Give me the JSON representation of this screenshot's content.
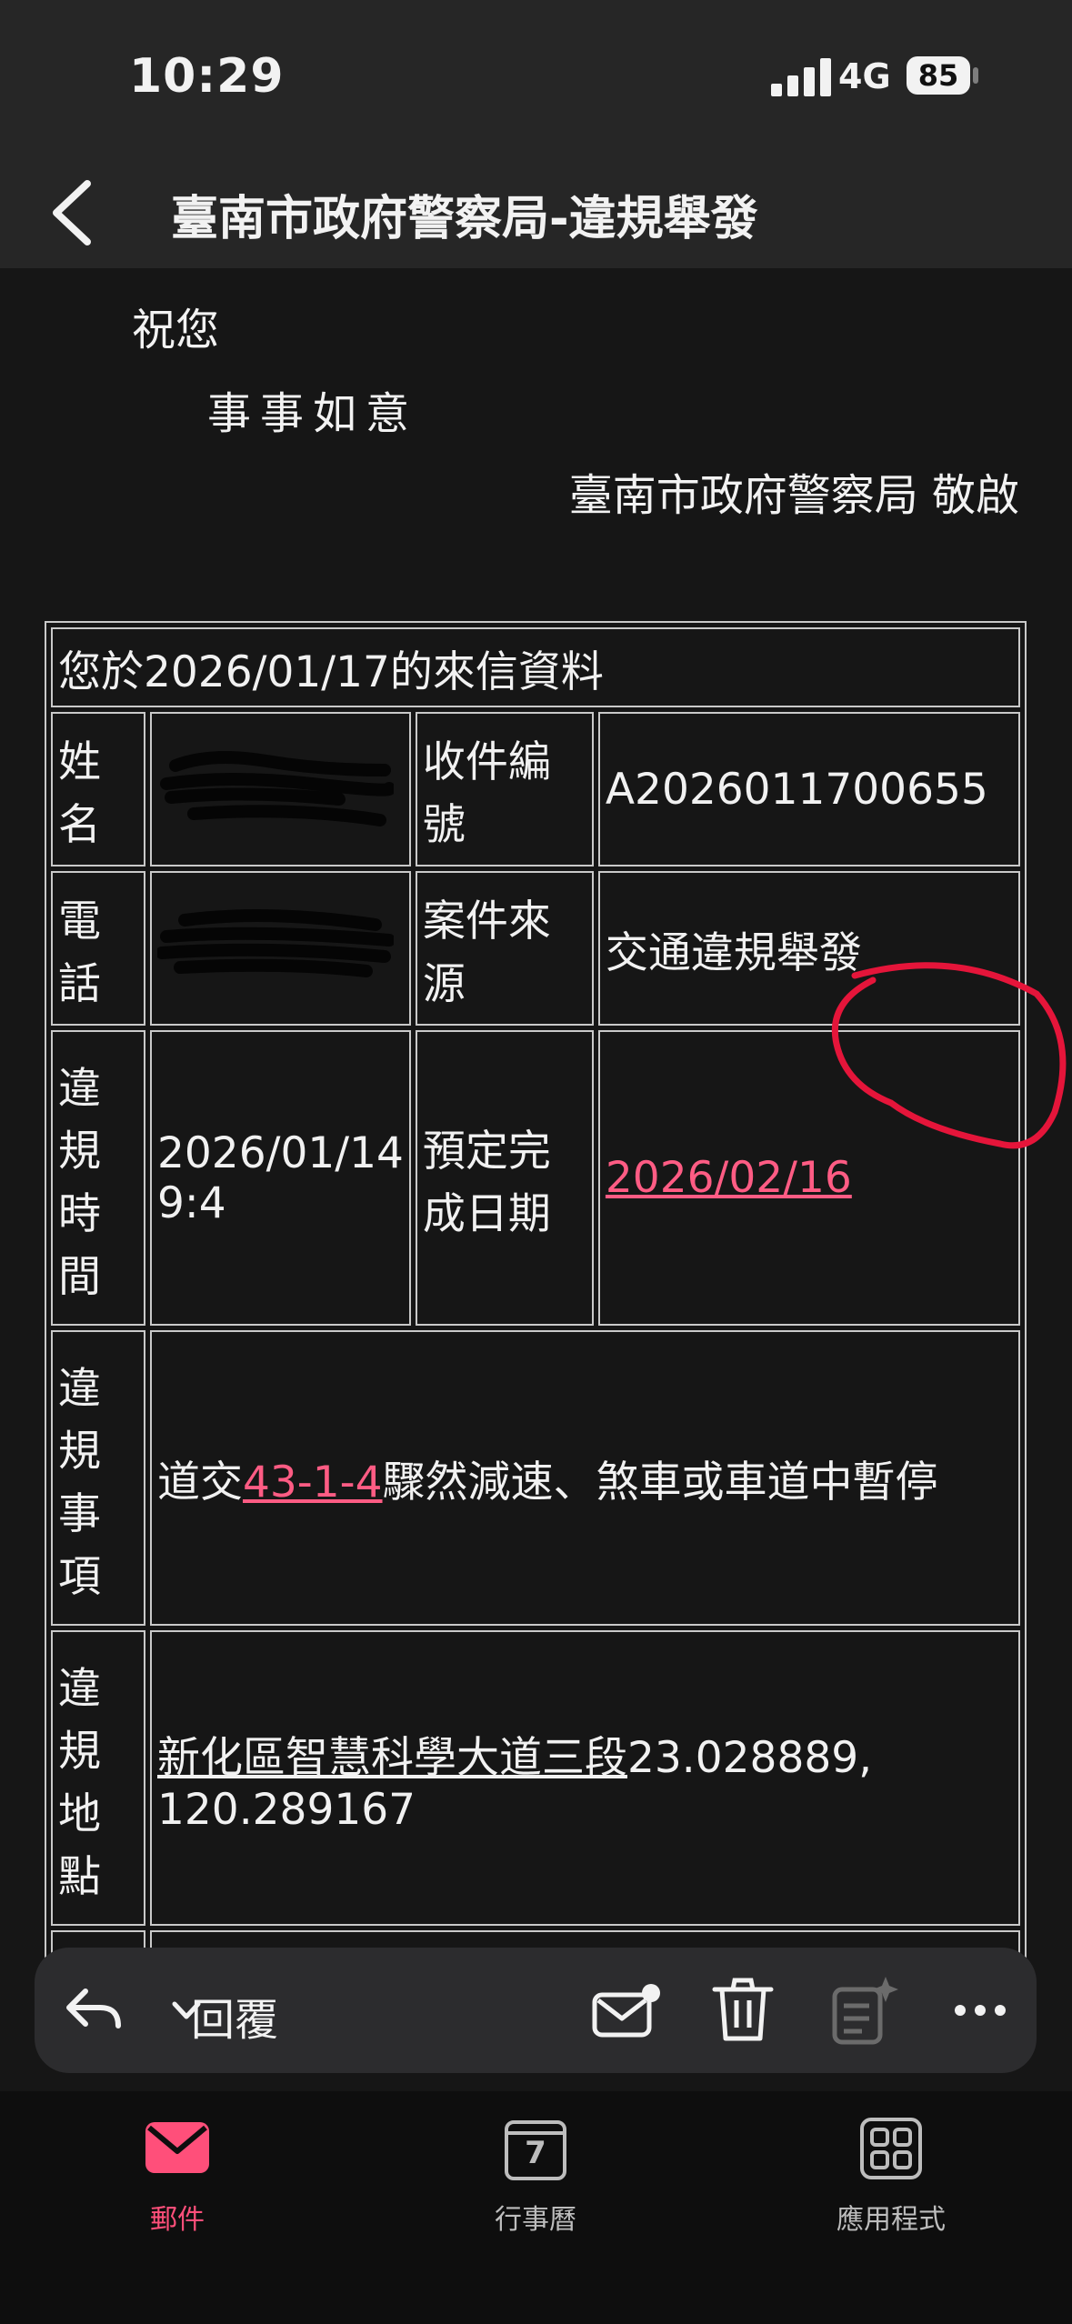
{
  "status": {
    "time": "10:29",
    "network": "4G",
    "battery": "85"
  },
  "nav": {
    "title": "臺南市政府警察局-違規舉發"
  },
  "email": {
    "greeting_line1": "祝您",
    "greeting_line2": "事事如意",
    "signature": "臺南市政府警察局  敬啟"
  },
  "table": {
    "header": "您於2026/01/17的來信資料",
    "name_label": "姓名",
    "case_no_label": "收件編號",
    "case_no": "A2026011700655",
    "phone_label": "電話",
    "source_label": "案件來源",
    "source": "交通違規舉發",
    "time_label": "違規時間",
    "time_value": "2026/01/14 9:4",
    "due_label": "預定完成日期",
    "due_value": "2026/02/16",
    "item_label": "違規事項",
    "item_prefix": "道交",
    "item_code": "43-1-4",
    "item_text": "驟然減速、煞車或車道中暫停",
    "location_label": "違規地點",
    "location_road": "新化區智慧科學大道三段",
    "location_coords": "23.028889, 120.289167"
  },
  "toolbar": {
    "reply_label": "回覆"
  },
  "tabs": {
    "mail": "郵件",
    "calendar": "行事曆",
    "calendar_day": "7",
    "apps": "應用程式"
  },
  "colors": {
    "accent": "#ff4f7a",
    "annotation": "#e5153a"
  }
}
